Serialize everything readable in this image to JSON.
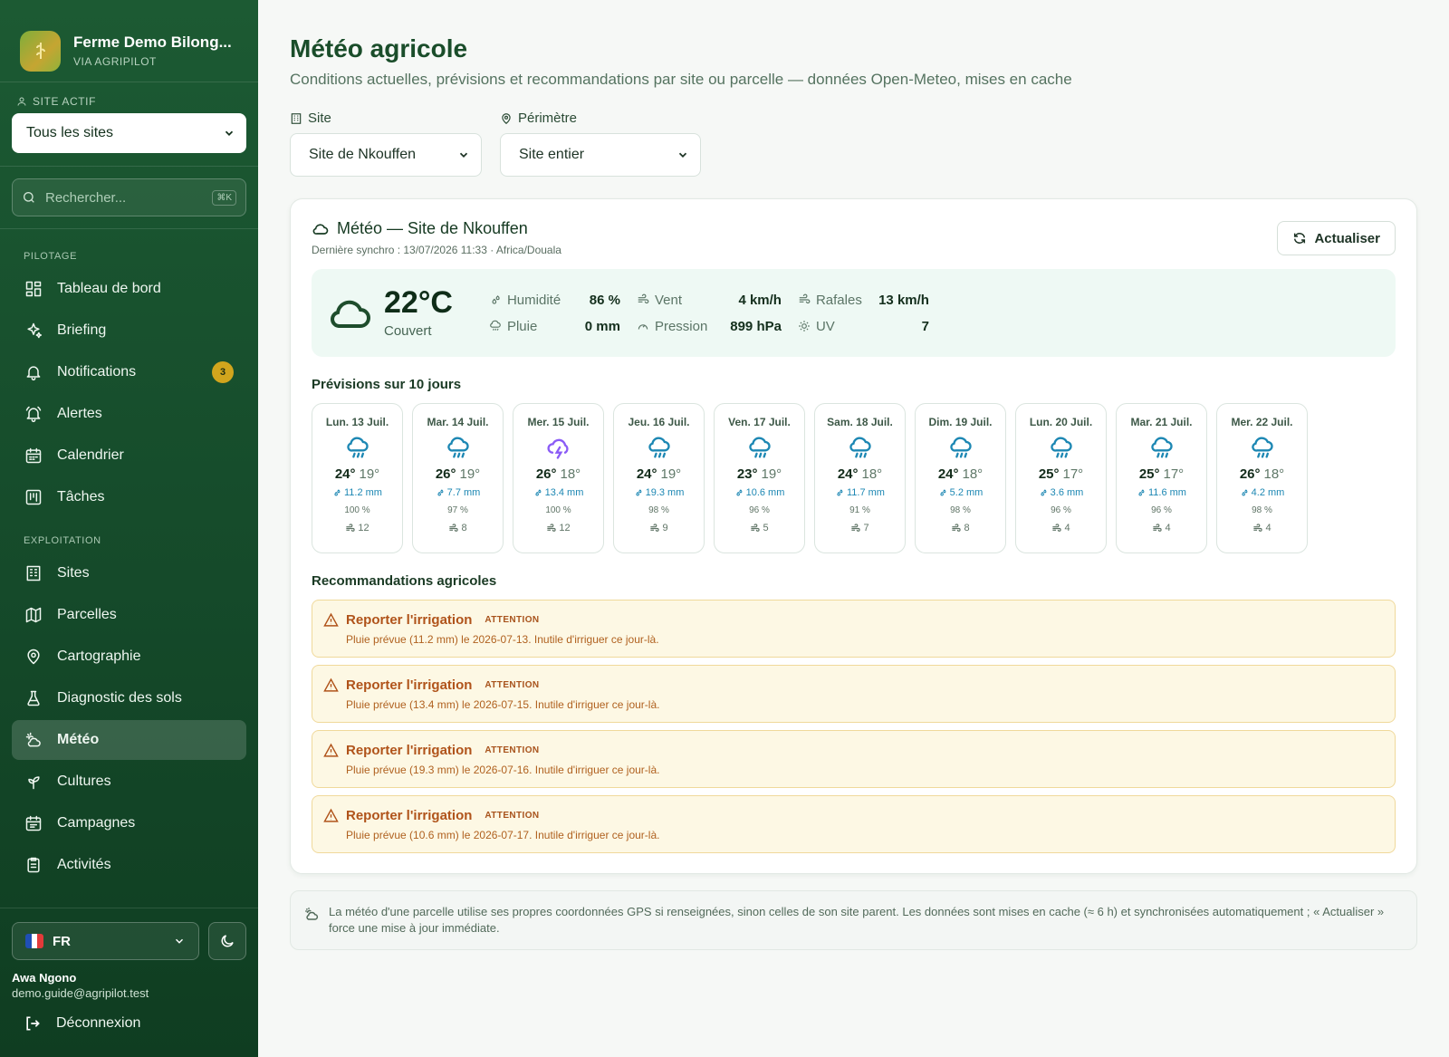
{
  "brand": {
    "name": "Ferme Demo Bilong...",
    "sub": "VIA AGRIPILOT"
  },
  "site_selector": {
    "label": "SITE ACTIF",
    "value": "Tous les sites"
  },
  "search": {
    "placeholder": "Rechercher...",
    "shortcut": "⌘K"
  },
  "nav": {
    "section_pilotage": "PILOTAGE",
    "section_exploitation": "EXPLOITATION",
    "items": [
      {
        "label": "Tableau de bord",
        "icon": "dashboard-icon"
      },
      {
        "label": "Briefing",
        "icon": "sparkles-icon"
      },
      {
        "label": "Notifications",
        "icon": "bell-icon",
        "badge": "3"
      },
      {
        "label": "Alertes",
        "icon": "bell-ring-icon"
      },
      {
        "label": "Calendrier",
        "icon": "calendar-icon"
      },
      {
        "label": "Tâches",
        "icon": "kanban-icon"
      },
      {
        "label": "Sites",
        "icon": "building-icon"
      },
      {
        "label": "Parcelles",
        "icon": "map-icon"
      },
      {
        "label": "Cartographie",
        "icon": "map-pin-icon"
      },
      {
        "label": "Diagnostic des sols",
        "icon": "flask-icon"
      },
      {
        "label": "Météo",
        "icon": "cloud-sun-icon",
        "active": true
      },
      {
        "label": "Cultures",
        "icon": "sprout-icon"
      },
      {
        "label": "Campagnes",
        "icon": "calendar-days-icon"
      },
      {
        "label": "Activités",
        "icon": "clipboard-icon"
      }
    ]
  },
  "footer": {
    "language": "FR",
    "user_name": "Awa Ngono",
    "user_email": "demo.guide@agripilot.test",
    "logout": "Déconnexion"
  },
  "page": {
    "title": "Météo agricole",
    "subtitle": "Conditions actuelles, prévisions et recommandations par site ou parcelle — données Open-Meteo, mises en cache"
  },
  "filters": {
    "site_label": "Site",
    "site_value": "Site de Nkouffen",
    "perimeter_label": "Périmètre",
    "perimeter_value": "Site entier"
  },
  "weather": {
    "title": "Météo — Site de Nkouffen",
    "sync": "Dernière synchro : 13/07/2026 11:33 · Africa/Douala",
    "refresh": "Actualiser",
    "current": {
      "temperature": "22°C",
      "condition": "Couvert",
      "humidity_label": "Humidité",
      "humidity": "86 %",
      "wind_label": "Vent",
      "wind": "4 km/h",
      "gusts_label": "Rafales",
      "gusts": "13 km/h",
      "rain_label": "Pluie",
      "rain": "0 mm",
      "pressure_label": "Pression",
      "pressure": "899 hPa",
      "uv_label": "UV",
      "uv": "7"
    },
    "forecast_title": "Prévisions sur 10 jours",
    "forecast": [
      {
        "day": "Lun. 13 Juil.",
        "icon": "rain-icon",
        "hi": "24°",
        "lo": "19°",
        "rain": "11.2 mm",
        "humidity": "100 %",
        "wind": "12"
      },
      {
        "day": "Mar. 14 Juil.",
        "icon": "rain-icon",
        "hi": "26°",
        "lo": "19°",
        "rain": "7.7 mm",
        "humidity": "97 %",
        "wind": "8"
      },
      {
        "day": "Mer. 15 Juil.",
        "icon": "storm-icon",
        "hi": "26°",
        "lo": "18°",
        "rain": "13.4 mm",
        "humidity": "100 %",
        "wind": "12"
      },
      {
        "day": "Jeu. 16 Juil.",
        "icon": "rain-icon",
        "hi": "24°",
        "lo": "19°",
        "rain": "19.3 mm",
        "humidity": "98 %",
        "wind": "9"
      },
      {
        "day": "Ven. 17 Juil.",
        "icon": "rain-icon",
        "hi": "23°",
        "lo": "19°",
        "rain": "10.6 mm",
        "humidity": "96 %",
        "wind": "5"
      },
      {
        "day": "Sam. 18 Juil.",
        "icon": "rain-icon",
        "hi": "24°",
        "lo": "18°",
        "rain": "11.7 mm",
        "humidity": "91 %",
        "wind": "7"
      },
      {
        "day": "Dim. 19 Juil.",
        "icon": "rain-icon",
        "hi": "24°",
        "lo": "18°",
        "rain": "5.2 mm",
        "humidity": "98 %",
        "wind": "8"
      },
      {
        "day": "Lun. 20 Juil.",
        "icon": "rain-icon",
        "hi": "25°",
        "lo": "17°",
        "rain": "3.6 mm",
        "humidity": "96 %",
        "wind": "4"
      },
      {
        "day": "Mar. 21 Juil.",
        "icon": "rain-icon",
        "hi": "25°",
        "lo": "17°",
        "rain": "11.6 mm",
        "humidity": "96 %",
        "wind": "4"
      },
      {
        "day": "Mer. 22 Juil.",
        "icon": "rain-icon",
        "hi": "26°",
        "lo": "18°",
        "rain": "4.2 mm",
        "humidity": "98 %",
        "wind": "4"
      }
    ],
    "reco_title": "Recommandations agricoles",
    "recommendations": [
      {
        "title": "Reporter l'irrigation",
        "tag": "ATTENTION",
        "text": "Pluie prévue (11.2 mm) le 2026-07-13. Inutile d'irriguer ce jour-là."
      },
      {
        "title": "Reporter l'irrigation",
        "tag": "ATTENTION",
        "text": "Pluie prévue (13.4 mm) le 2026-07-15. Inutile d'irriguer ce jour-là."
      },
      {
        "title": "Reporter l'irrigation",
        "tag": "ATTENTION",
        "text": "Pluie prévue (19.3 mm) le 2026-07-16. Inutile d'irriguer ce jour-là."
      },
      {
        "title": "Reporter l'irrigation",
        "tag": "ATTENTION",
        "text": "Pluie prévue (10.6 mm) le 2026-07-17. Inutile d'irriguer ce jour-là."
      }
    ]
  },
  "note": "La météo d'une parcelle utilise ses propres coordonnées GPS si renseignées, sinon celles de son site parent. Les données sont mises en cache (≈ 6 h) et synchronisées automatiquement ; « Actualiser » force une mise à jour immédiate.",
  "colors": {
    "sidebar": "#1c5a33",
    "accent": "#1a4d2a",
    "rain": "#1c87b3",
    "storm": "#8b5cf6",
    "warning": "#b0531a"
  }
}
